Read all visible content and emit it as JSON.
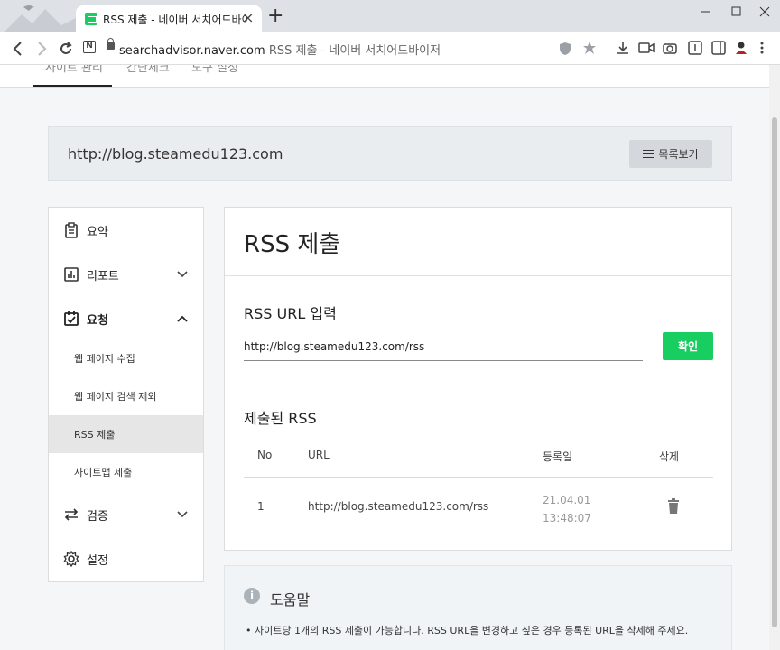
{
  "browser": {
    "tab_title": "RSS 제출 - 네이버 서치어드바이",
    "tab_close": "×",
    "new_tab": "+",
    "url_domain": "searchadvisor.naver.com",
    "url_title": "RSS 제출 - 네이버 서치어드바이저",
    "n_badge": "N"
  },
  "topnav": {
    "items": [
      "사이트 관리",
      "간단체크",
      "도구 설정"
    ]
  },
  "site": {
    "url": "http://blog.steamedu123.com",
    "list_button": "목록보기"
  },
  "sidebar": {
    "items": [
      {
        "label": "요약",
        "icon": "clipboard-icon"
      },
      {
        "label": "리포트",
        "icon": "bar-chart-icon"
      },
      {
        "label": "요청",
        "icon": "calendar-check-icon"
      },
      {
        "label": "검증",
        "icon": "swap-arrows-icon"
      },
      {
        "label": "설정",
        "icon": "gear-icon"
      }
    ],
    "sub_items": [
      "웹 페이지 수집",
      "웹 페이지 검색 제외",
      "RSS 제출",
      "사이트맵 제출"
    ]
  },
  "main": {
    "title": "RSS 제출",
    "input_section": "RSS URL 입력",
    "input_value": "http://blog.steamedu123.com/rss",
    "confirm_button": "확인",
    "submitted_section": "제출된 RSS",
    "columns": [
      "No",
      "URL",
      "등록일",
      "삭제"
    ],
    "rows": [
      {
        "no": "1",
        "url": "http://blog.steamedu123.com/rss",
        "date": "21.04.01 13:48:07"
      }
    ]
  },
  "help": {
    "title": "도움말",
    "info_glyph": "i",
    "bullet": "사이트당 1개의 RSS 제출이 가능합니다. RSS URL을 변경하고 싶은 경우 등록된 URL을 삭제해 주세요."
  },
  "colors": {
    "accent": "#19ce60",
    "page_bg": "#f5f6f7"
  }
}
